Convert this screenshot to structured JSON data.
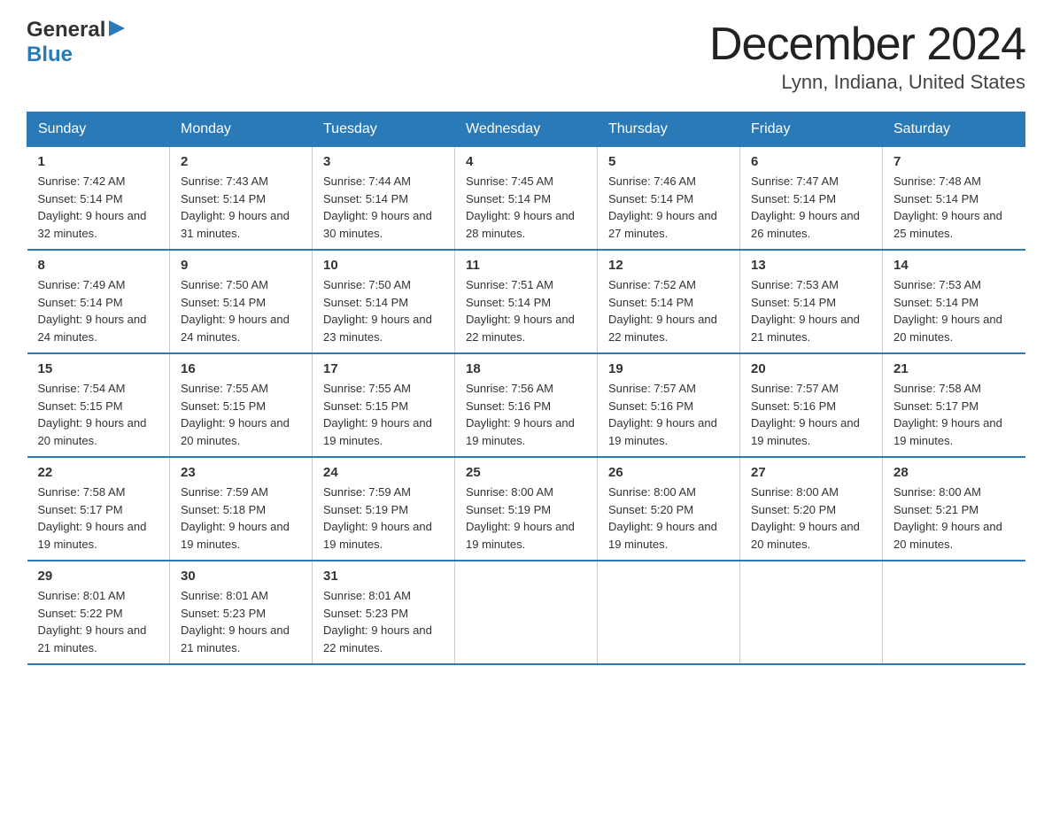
{
  "logo": {
    "general": "General",
    "blue": "Blue",
    "arrow": "▶"
  },
  "title": "December 2024",
  "subtitle": "Lynn, Indiana, United States",
  "days_of_week": [
    "Sunday",
    "Monday",
    "Tuesday",
    "Wednesday",
    "Thursday",
    "Friday",
    "Saturday"
  ],
  "weeks": [
    [
      {
        "day": "1",
        "sunrise": "7:42 AM",
        "sunset": "5:14 PM",
        "daylight": "9 hours and 32 minutes."
      },
      {
        "day": "2",
        "sunrise": "7:43 AM",
        "sunset": "5:14 PM",
        "daylight": "9 hours and 31 minutes."
      },
      {
        "day": "3",
        "sunrise": "7:44 AM",
        "sunset": "5:14 PM",
        "daylight": "9 hours and 30 minutes."
      },
      {
        "day": "4",
        "sunrise": "7:45 AM",
        "sunset": "5:14 PM",
        "daylight": "9 hours and 28 minutes."
      },
      {
        "day": "5",
        "sunrise": "7:46 AM",
        "sunset": "5:14 PM",
        "daylight": "9 hours and 27 minutes."
      },
      {
        "day": "6",
        "sunrise": "7:47 AM",
        "sunset": "5:14 PM",
        "daylight": "9 hours and 26 minutes."
      },
      {
        "day": "7",
        "sunrise": "7:48 AM",
        "sunset": "5:14 PM",
        "daylight": "9 hours and 25 minutes."
      }
    ],
    [
      {
        "day": "8",
        "sunrise": "7:49 AM",
        "sunset": "5:14 PM",
        "daylight": "9 hours and 24 minutes."
      },
      {
        "day": "9",
        "sunrise": "7:50 AM",
        "sunset": "5:14 PM",
        "daylight": "9 hours and 24 minutes."
      },
      {
        "day": "10",
        "sunrise": "7:50 AM",
        "sunset": "5:14 PM",
        "daylight": "9 hours and 23 minutes."
      },
      {
        "day": "11",
        "sunrise": "7:51 AM",
        "sunset": "5:14 PM",
        "daylight": "9 hours and 22 minutes."
      },
      {
        "day": "12",
        "sunrise": "7:52 AM",
        "sunset": "5:14 PM",
        "daylight": "9 hours and 22 minutes."
      },
      {
        "day": "13",
        "sunrise": "7:53 AM",
        "sunset": "5:14 PM",
        "daylight": "9 hours and 21 minutes."
      },
      {
        "day": "14",
        "sunrise": "7:53 AM",
        "sunset": "5:14 PM",
        "daylight": "9 hours and 20 minutes."
      }
    ],
    [
      {
        "day": "15",
        "sunrise": "7:54 AM",
        "sunset": "5:15 PM",
        "daylight": "9 hours and 20 minutes."
      },
      {
        "day": "16",
        "sunrise": "7:55 AM",
        "sunset": "5:15 PM",
        "daylight": "9 hours and 20 minutes."
      },
      {
        "day": "17",
        "sunrise": "7:55 AM",
        "sunset": "5:15 PM",
        "daylight": "9 hours and 19 minutes."
      },
      {
        "day": "18",
        "sunrise": "7:56 AM",
        "sunset": "5:16 PM",
        "daylight": "9 hours and 19 minutes."
      },
      {
        "day": "19",
        "sunrise": "7:57 AM",
        "sunset": "5:16 PM",
        "daylight": "9 hours and 19 minutes."
      },
      {
        "day": "20",
        "sunrise": "7:57 AM",
        "sunset": "5:16 PM",
        "daylight": "9 hours and 19 minutes."
      },
      {
        "day": "21",
        "sunrise": "7:58 AM",
        "sunset": "5:17 PM",
        "daylight": "9 hours and 19 minutes."
      }
    ],
    [
      {
        "day": "22",
        "sunrise": "7:58 AM",
        "sunset": "5:17 PM",
        "daylight": "9 hours and 19 minutes."
      },
      {
        "day": "23",
        "sunrise": "7:59 AM",
        "sunset": "5:18 PM",
        "daylight": "9 hours and 19 minutes."
      },
      {
        "day": "24",
        "sunrise": "7:59 AM",
        "sunset": "5:19 PM",
        "daylight": "9 hours and 19 minutes."
      },
      {
        "day": "25",
        "sunrise": "8:00 AM",
        "sunset": "5:19 PM",
        "daylight": "9 hours and 19 minutes."
      },
      {
        "day": "26",
        "sunrise": "8:00 AM",
        "sunset": "5:20 PM",
        "daylight": "9 hours and 19 minutes."
      },
      {
        "day": "27",
        "sunrise": "8:00 AM",
        "sunset": "5:20 PM",
        "daylight": "9 hours and 20 minutes."
      },
      {
        "day": "28",
        "sunrise": "8:00 AM",
        "sunset": "5:21 PM",
        "daylight": "9 hours and 20 minutes."
      }
    ],
    [
      {
        "day": "29",
        "sunrise": "8:01 AM",
        "sunset": "5:22 PM",
        "daylight": "9 hours and 21 minutes."
      },
      {
        "day": "30",
        "sunrise": "8:01 AM",
        "sunset": "5:23 PM",
        "daylight": "9 hours and 21 minutes."
      },
      {
        "day": "31",
        "sunrise": "8:01 AM",
        "sunset": "5:23 PM",
        "daylight": "9 hours and 22 minutes."
      },
      null,
      null,
      null,
      null
    ]
  ],
  "labels": {
    "sunrise": "Sunrise:",
    "sunset": "Sunset:",
    "daylight": "Daylight:"
  }
}
